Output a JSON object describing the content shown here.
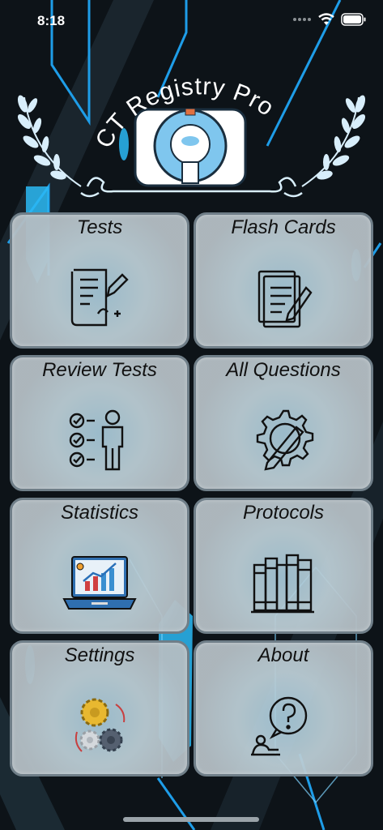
{
  "status_bar": {
    "time": "8:18"
  },
  "header": {
    "app_title": "CT Registry Pro"
  },
  "menu": {
    "tests": {
      "label": "Tests",
      "icon": "document-pencil-icon"
    },
    "flash_cards": {
      "label": "Flash Cards",
      "icon": "cards-pen-icon"
    },
    "review_tests": {
      "label": "Review Tests",
      "icon": "checklist-person-icon"
    },
    "all_questions": {
      "label": "All Questions",
      "icon": "gear-pencil-icon"
    },
    "statistics": {
      "label": "Statistics",
      "icon": "laptop-chart-icon"
    },
    "protocols": {
      "label": "Protocols",
      "icon": "books-icon"
    },
    "settings": {
      "label": "Settings",
      "icon": "gears-icon"
    },
    "about": {
      "label": "About",
      "icon": "question-person-icon"
    }
  },
  "colors": {
    "background": "#0d1318",
    "accent_blue": "#22b4ff",
    "tile_border": "#6f7e88"
  }
}
